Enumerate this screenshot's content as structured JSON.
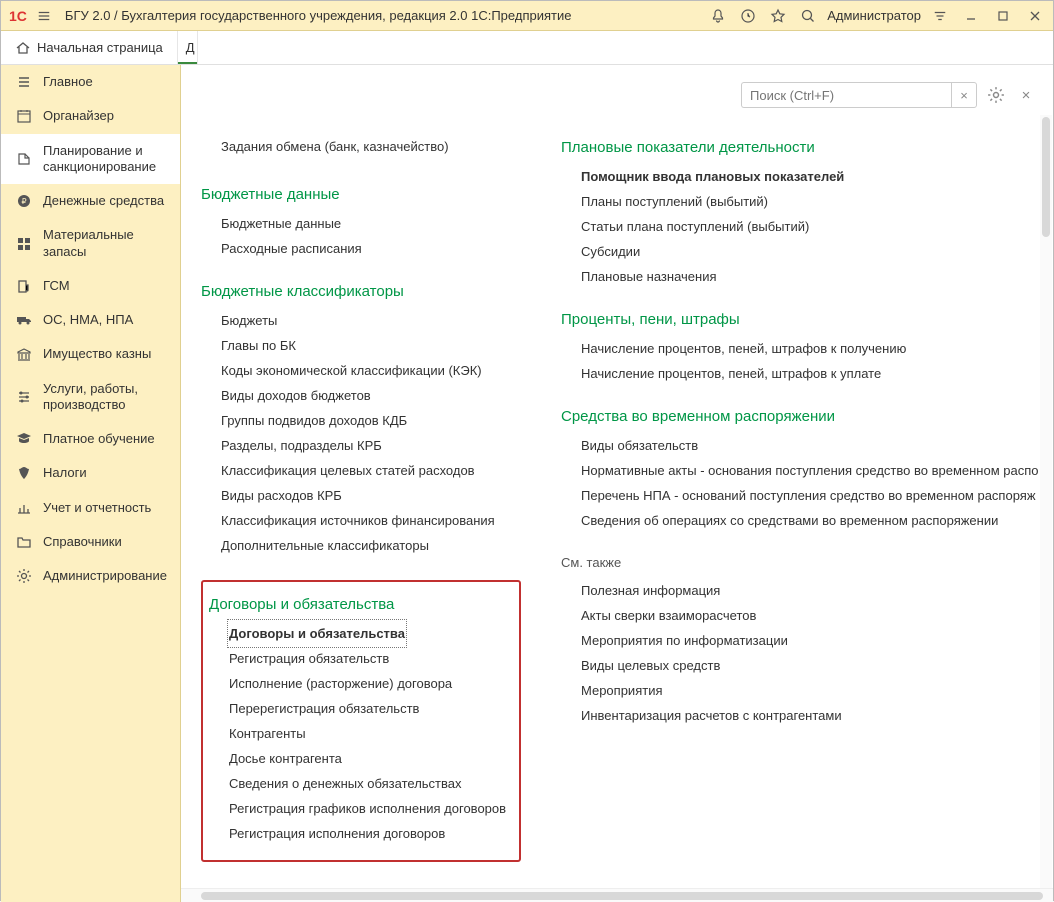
{
  "titlebar": {
    "title": "БГУ 2.0 / Бухгалтерия государственного учреждения, редакция 2.0 1С:Предприятие",
    "user": "Администратор"
  },
  "tabbar": {
    "home": "Начальная страница",
    "tab2": "Д"
  },
  "sidebar": {
    "items": [
      {
        "label": "Главное"
      },
      {
        "label": "Органайзер"
      },
      {
        "label": "Планирование и санкционирование"
      },
      {
        "label": "Денежные средства"
      },
      {
        "label": "Материальные запасы"
      },
      {
        "label": "ГСМ"
      },
      {
        "label": "ОС, НМА, НПА"
      },
      {
        "label": "Имущество казны"
      },
      {
        "label": "Услуги, работы, производство"
      },
      {
        "label": "Платное обучение"
      },
      {
        "label": "Налоги"
      },
      {
        "label": "Учет и отчетность"
      },
      {
        "label": "Справочники"
      },
      {
        "label": "Администрирование"
      }
    ]
  },
  "search": {
    "placeholder": "Поиск (Ctrl+F)",
    "clear": "×"
  },
  "content": {
    "stray": "Задания обмена (банк, казначейство)",
    "left_groups": [
      {
        "header": "Бюджетные данные",
        "items": [
          "Бюджетные данные",
          "Расходные расписания"
        ]
      },
      {
        "header": "Бюджетные классификаторы",
        "items": [
          "Бюджеты",
          "Главы по БК",
          "Коды экономической классификации (КЭК)",
          "Виды доходов бюджетов",
          "Группы подвидов доходов КДБ",
          "Разделы, подразделы КРБ",
          "Классификация целевых статей расходов",
          "Виды расходов КРБ",
          "Классификация источников финансирования",
          "Дополнительные классификаторы"
        ]
      }
    ],
    "highlight": {
      "header": "Договоры и обязательства",
      "dotted": "Договоры и обязательства",
      "items": [
        "Регистрация обязательств",
        "Исполнение (расторжение) договора",
        "Перерегистрация обязательств",
        "Контрагенты",
        "Досье контрагента",
        "Сведения о денежных обязательствах",
        "Регистрация графиков исполнения договоров",
        "Регистрация исполнения договоров"
      ]
    },
    "right_groups": [
      {
        "header": "Плановые показатели деятельности",
        "bold": "Помощник ввода плановых показателей",
        "items": [
          "Планы поступлений (выбытий)",
          "Статьи плана поступлений (выбытий)",
          "Субсидии",
          "Плановые назначения"
        ]
      },
      {
        "header": "Проценты, пени, штрафы",
        "items": [
          "Начисление процентов, пеней, штрафов к получению",
          "Начисление процентов, пеней, штрафов к уплате"
        ]
      },
      {
        "header": "Средства во временном распоряжении",
        "items": [
          "Виды обязательств",
          "Нормативные акты - основания  поступления средство во временном распо",
          "Перечень НПА - оснований поступления средство во временном распоряж",
          "Сведения об операциях со средствами во временном распоряжении"
        ]
      }
    ],
    "see_also_header": "См. также",
    "see_also": [
      "Полезная информация",
      "Акты сверки взаиморасчетов",
      "Мероприятия по информатизации",
      "Виды целевых средств",
      "Мероприятия",
      "Инвентаризация расчетов с контрагентами"
    ]
  }
}
